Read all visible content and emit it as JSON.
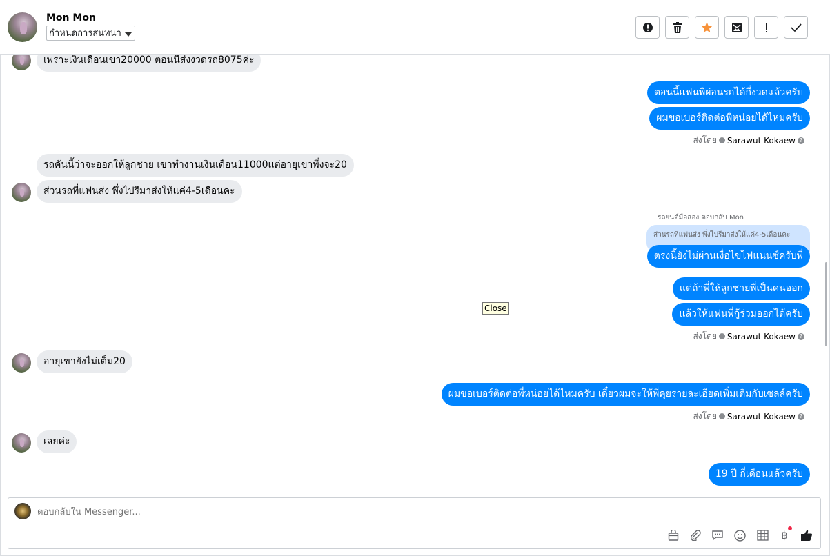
{
  "header": {
    "contact_name": "Mon Mon",
    "label_select": "กำหนดการสนทนา"
  },
  "toolbar": {
    "buttons": [
      "spam",
      "delete",
      "star",
      "mark-unread",
      "important",
      "done"
    ]
  },
  "messages": {
    "m1": "เพราะเงินเดือนเขา20000 ตอนนี้ส่งงวดรถ8075ค่ะ",
    "m2": "ตอนนี้แฟนพี่ผ่อนรถได้กี่งวดแล้วครับ",
    "m3": "ผมขอเบอร์ติดต่อพี่หน่อยได้ไหมครับ",
    "m4": "รถคันนี้ว่าจะออกให้ลูกชาย เขาทำงานเงินเดือน11000แต่อายุเขาพึ่งจะ20",
    "m5": "ส่วนรถที่แฟนส่ง พึ่งไปรีมาส่งให้แค่4-5เดือนคะ",
    "reply_note": "รถยนต์มือสอง ตอบกลับ Mon",
    "quoted": "ส่วนรถที่แฟนส่ง พึ่งไปรีมาส่งให้แค่4-5เดือนคะ",
    "m6": "ตรงนี้ยังไม่ผ่านเงื่อไขไฟแนนซ์ครับพี่",
    "m7": "แต่ถ้าพี่ให้ลูกชายพี่เป็นคนออก",
    "m8": "แล้วให้แฟนพี่กู้ร่วมออกได้ครับ",
    "m9": "อายุเขายังไม่เต็ม20",
    "m10": "ผมขอเบอร์ติดต่อพี่หน่อยได้ไหมครับ เดี๋ยวผมจะให้พี่คุยรายละเอียดเพิ่มเติมกับเซลล์ครับ",
    "m11": "เลยค่ะ",
    "m12": "19 ปี กี่เดือนแล้วครับ"
  },
  "sent_by": {
    "prefix": "ส่งโดย",
    "agent": "Sarawut Kokaew"
  },
  "tooltip": "Close",
  "composer": {
    "placeholder": "ตอบกลับใน Messenger...",
    "icons": [
      "bag-icon",
      "paperclip-icon",
      "saved-reply-icon",
      "emoji-icon",
      "table-icon",
      "baht-icon",
      "like-icon"
    ]
  },
  "colors": {
    "outgoing": "#0084ff",
    "incoming": "#e9ebee",
    "star": "#f7923a"
  }
}
